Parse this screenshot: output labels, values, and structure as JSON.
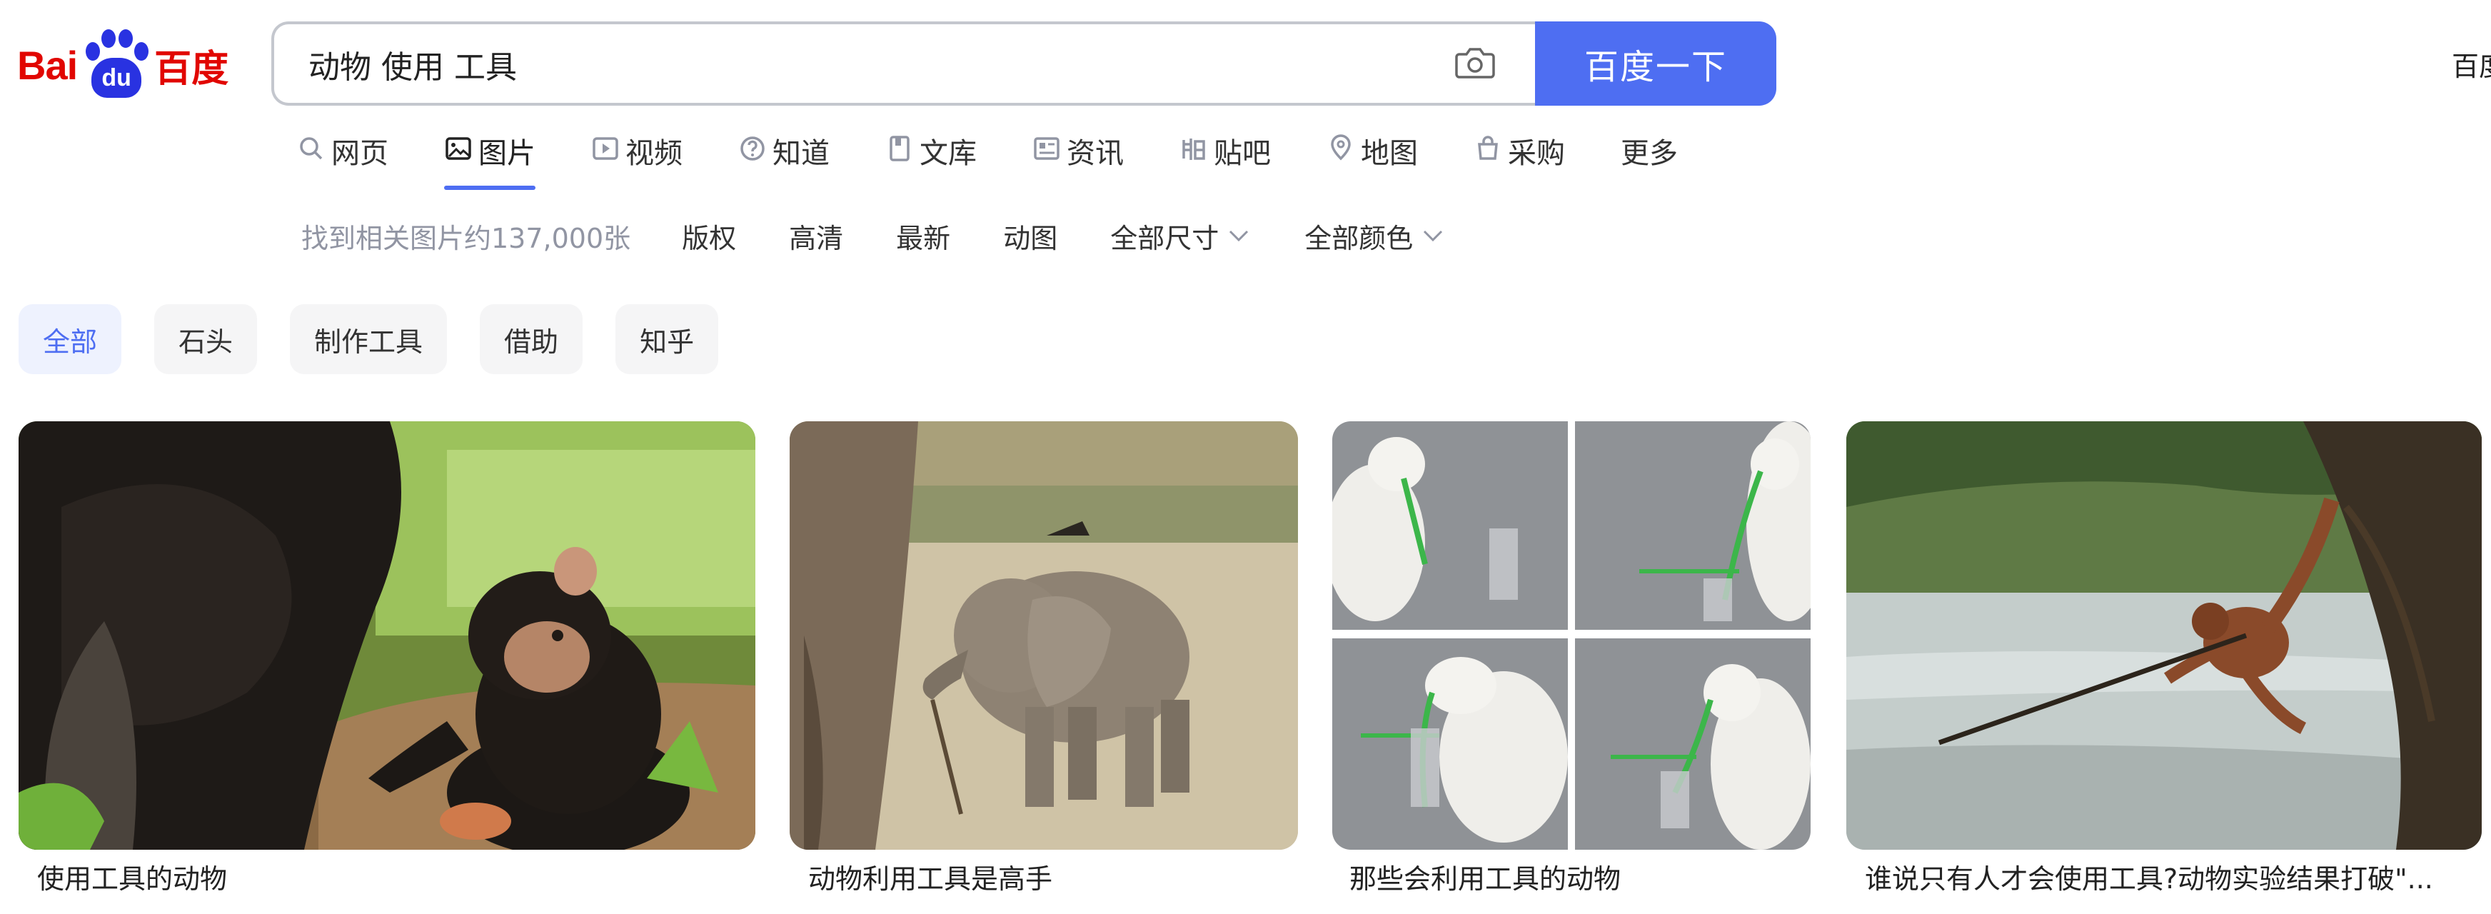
{
  "logo": {
    "latin": "Bai",
    "paw_text": "du",
    "cn": "百度"
  },
  "search": {
    "query": "动物 使用 工具",
    "button": "百度一下"
  },
  "top_right": "百度",
  "tabs": [
    {
      "label": "网页",
      "icon": "search-icon"
    },
    {
      "label": "图片",
      "icon": "image-icon",
      "active": true
    },
    {
      "label": "视频",
      "icon": "video-icon"
    },
    {
      "label": "知道",
      "icon": "question-icon"
    },
    {
      "label": "文库",
      "icon": "document-icon"
    },
    {
      "label": "资讯",
      "icon": "news-icon"
    },
    {
      "label": "贴吧",
      "icon": "tieba-icon"
    },
    {
      "label": "地图",
      "icon": "map-icon"
    },
    {
      "label": "采购",
      "icon": "shopping-icon"
    },
    {
      "label": "更多"
    }
  ],
  "filters": {
    "result_count": "找到相关图片约137,000张",
    "items": [
      "版权",
      "高清",
      "最新",
      "动图",
      "全部尺寸",
      "全部颜色"
    ]
  },
  "chips": [
    "全部",
    "石头",
    "制作工具",
    "借助",
    "知乎"
  ],
  "images": [
    {
      "caption": "使用工具的动物"
    },
    {
      "caption": "动物利用工具是高手"
    },
    {
      "caption": "那些会利用工具的动物"
    },
    {
      "caption": "谁说只有人才会使用工具?动物实验结果打破\"..."
    }
  ],
  "colors": {
    "brand_blue": "#4e6ef2",
    "logo_red": "#e10601",
    "logo_blue": "#2932e1"
  }
}
